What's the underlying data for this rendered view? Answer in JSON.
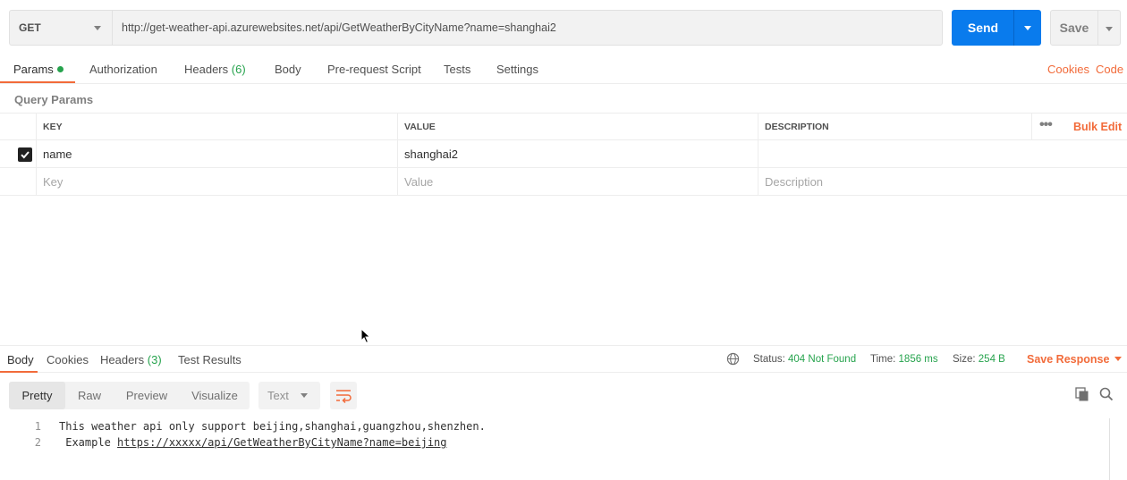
{
  "request": {
    "method": "GET",
    "url": "http://get-weather-api.azurewebsites.net/api/GetWeatherByCityName?name=shanghai2",
    "send_label": "Send",
    "save_label": "Save"
  },
  "tabs": [
    {
      "label": "Params"
    },
    {
      "label": "Authorization"
    },
    {
      "label": "Headers",
      "count": "(6)"
    },
    {
      "label": "Body"
    },
    {
      "label": "Pre-request Script"
    },
    {
      "label": "Tests"
    },
    {
      "label": "Settings"
    }
  ],
  "right_links": {
    "cookies": "Cookies",
    "code": "Code"
  },
  "query_params": {
    "section_label": "Query Params",
    "columns": {
      "key": "KEY",
      "value": "VALUE",
      "description": "DESCRIPTION"
    },
    "bulk_edit": "Bulk Edit",
    "rows": [
      {
        "checked": true,
        "key": "name",
        "value": "shanghai2",
        "description": ""
      }
    ],
    "placeholders": {
      "key": "Key",
      "value": "Value",
      "description": "Description"
    }
  },
  "response": {
    "tabs": [
      {
        "label": "Body"
      },
      {
        "label": "Cookies"
      },
      {
        "label": "Headers",
        "count": "(3)"
      },
      {
        "label": "Test Results"
      }
    ],
    "status_label": "Status:",
    "status_value": "404 Not Found",
    "time_label": "Time:",
    "time_value": "1856 ms",
    "size_label": "Size:",
    "size_value": "254 B",
    "save_response": "Save Response",
    "view_modes": [
      "Pretty",
      "Raw",
      "Preview",
      "Visualize"
    ],
    "format": "Text",
    "lines": [
      {
        "num": "1",
        "text": "This weather api only support beijing,shanghai,guangzhou,shenzhen."
      },
      {
        "num": "2",
        "prefix": " Example ",
        "link": "https://xxxxx/api/GetWeatherByCityName?name=beijing"
      }
    ]
  },
  "colors": {
    "accent": "#f26b3a",
    "primary": "#097bed",
    "success": "#26a34d"
  }
}
